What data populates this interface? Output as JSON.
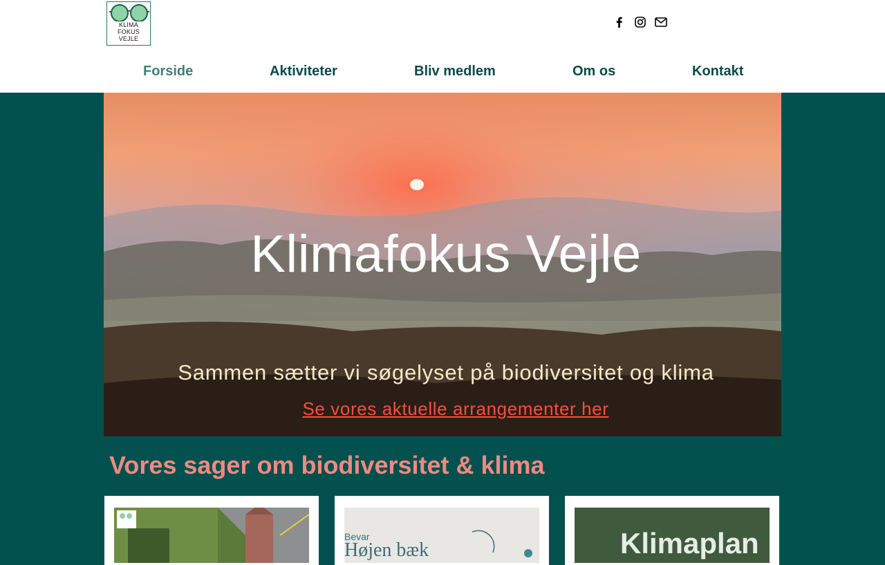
{
  "logo": {
    "lines": [
      "KLIMA",
      "FOKUS",
      "VEJLE"
    ]
  },
  "social": {
    "icons": [
      "facebook-icon",
      "instagram-icon",
      "mail-icon"
    ]
  },
  "nav": {
    "items": [
      "Forside",
      "Aktiviteter",
      "Bliv medlem",
      "Om os",
      "Kontakt"
    ],
    "active": "Forside"
  },
  "hero": {
    "title": "Klimafokus Vejle",
    "subtitle": "Sammen sætter vi søgelyset på biodiversitet og klima",
    "cta": "Se vores aktuelle arrangementer her"
  },
  "section": {
    "title": "Vores sager om biodiversitet & klima"
  },
  "cards": [
    {
      "image_text": ""
    },
    {
      "image_text_small": "Bevar",
      "image_text_large": "Højen bæk"
    },
    {
      "image_text": "Klimaplan"
    }
  ],
  "colors": {
    "background": "#02514f",
    "nav_text": "#0b4a47",
    "nav_active": "#3f7f78",
    "accent_link": "#ff4b3e",
    "section_title": "#f08a80"
  }
}
